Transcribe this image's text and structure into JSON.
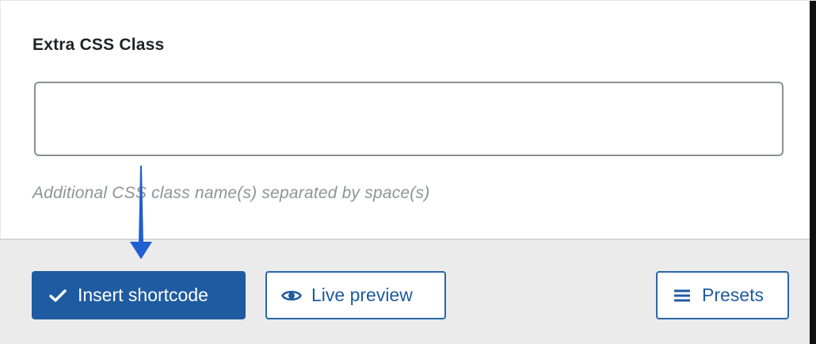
{
  "form": {
    "field_label": "Extra CSS Class",
    "input_value": "",
    "input_placeholder": "",
    "help_text": "Additional CSS class name(s) separated by space(s)"
  },
  "footer": {
    "insert_label": "Insert shortcode",
    "insert_icon": "checkmark-icon",
    "preview_label": "Live preview",
    "preview_icon": "eye-icon",
    "presets_label": "Presets",
    "presets_icon": "menu-lines-icon"
  },
  "annotation": {
    "arrow_icon": "down-arrow-icon",
    "arrow_color": "#1f5fd0"
  },
  "colors": {
    "primary": "#1f5ba0",
    "footer_bg": "#ebebec",
    "help_text": "#8f9397"
  }
}
